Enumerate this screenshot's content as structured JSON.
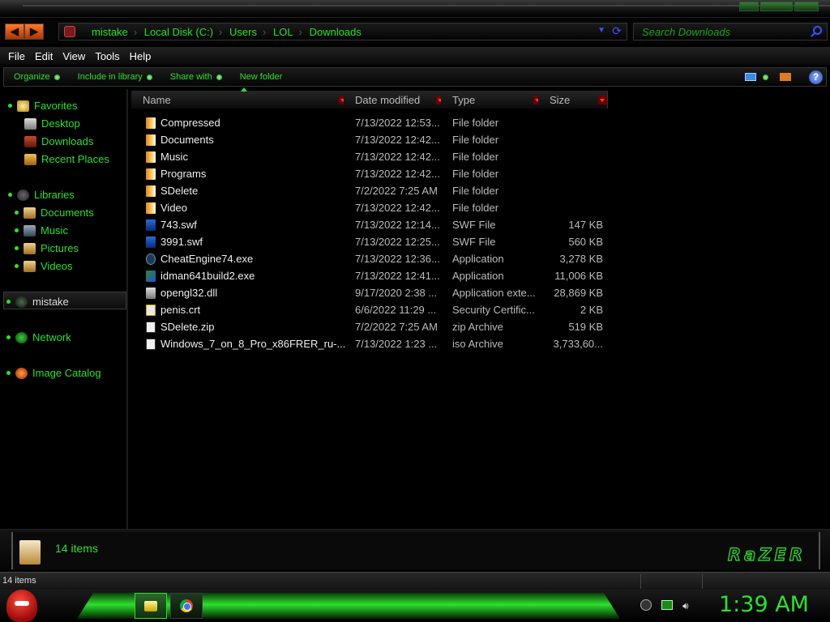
{
  "address": {
    "crumbs": [
      "mistake",
      "Local Disk (C:)",
      "Users",
      "LOL",
      "Downloads"
    ]
  },
  "search": {
    "placeholder": "Search Downloads"
  },
  "menu": [
    "File",
    "Edit",
    "View",
    "Tools",
    "Help"
  ],
  "commands": [
    "Organize",
    "Include in library",
    "Share with",
    "New folder"
  ],
  "nav": {
    "favorites": "Favorites",
    "favorite_items": [
      "Desktop",
      "Downloads",
      "Recent Places"
    ],
    "libraries": "Libraries",
    "library_items": [
      "Documents",
      "Music",
      "Pictures",
      "Videos"
    ],
    "homegroup": "mistake",
    "network": "Network",
    "image_catalog": "Image Catalog"
  },
  "columns": [
    "Name",
    "Date modified",
    "Type",
    "Size"
  ],
  "files": [
    {
      "name": "Compressed",
      "date": "7/13/2022 12:53...",
      "type": "File folder",
      "size": "",
      "icon": "folder-icon"
    },
    {
      "name": "Documents",
      "date": "7/13/2022 12:42...",
      "type": "File folder",
      "size": "",
      "icon": "folder-icon"
    },
    {
      "name": "Music",
      "date": "7/13/2022 12:42...",
      "type": "File folder",
      "size": "",
      "icon": "folder-icon"
    },
    {
      "name": "Programs",
      "date": "7/13/2022 12:42...",
      "type": "File folder",
      "size": "",
      "icon": "folder-icon"
    },
    {
      "name": "SDelete",
      "date": "7/2/2022 7:25 AM",
      "type": "File folder",
      "size": "",
      "icon": "folder-icon"
    },
    {
      "name": "Video",
      "date": "7/13/2022 12:42...",
      "type": "File folder",
      "size": "",
      "icon": "folder-icon"
    },
    {
      "name": "743.swf",
      "date": "7/13/2022 12:14...",
      "type": "SWF File",
      "size": "147 KB",
      "icon": "swf-icon"
    },
    {
      "name": "3991.swf",
      "date": "7/13/2022 12:25...",
      "type": "SWF File",
      "size": "560 KB",
      "icon": "swf-icon"
    },
    {
      "name": "CheatEngine74.exe",
      "date": "7/13/2022 12:36...",
      "type": "Application",
      "size": "3,278 KB",
      "icon": "app-icon"
    },
    {
      "name": "idman641build2.exe",
      "date": "7/13/2022 12:41...",
      "type": "Application",
      "size": "11,006 KB",
      "icon": "idm-icon"
    },
    {
      "name": "opengl32.dll",
      "date": "9/17/2020 2:38 ...",
      "type": "Application exte...",
      "size": "28,869 KB",
      "icon": "dll-icon"
    },
    {
      "name": "penis.crt",
      "date": "6/6/2022 11:29 ...",
      "type": "Security Certific...",
      "size": "2 KB",
      "icon": "cert-icon"
    },
    {
      "name": "SDelete.zip",
      "date": "7/2/2022 7:25 AM",
      "type": "zip Archive",
      "size": "519 KB",
      "icon": "zip-icon"
    },
    {
      "name": "Windows_7_on_8_Pro_x86FRER_ru-...",
      "date": "7/13/2022 1:23 ...",
      "type": "iso Archive",
      "size": "3,733,60...",
      "icon": "iso-icon"
    }
  ],
  "details": {
    "count": "14 items",
    "brand": "RaZER"
  },
  "status": {
    "text": "14 items"
  },
  "taskbar": {
    "clock": "1:39 AM"
  },
  "colors": {
    "accent": "#2ee02e",
    "background": "#000000",
    "nav_arrows": "#ff6a1a"
  }
}
